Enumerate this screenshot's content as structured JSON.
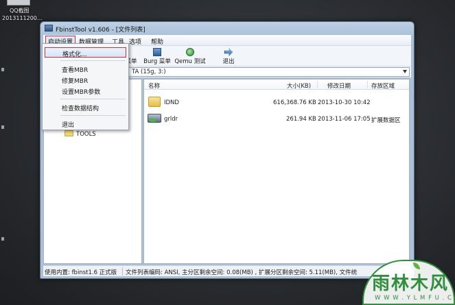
{
  "desktop": {
    "icon_label_1": "QQ截图",
    "icon_label_2": "2013111200..."
  },
  "window": {
    "title": "FbinstTool v1.606 - [文件列表]"
  },
  "menubar": {
    "items": [
      "启动设置",
      "数据管理",
      "工具",
      "选项",
      "帮助"
    ]
  },
  "toolbar": {
    "partial_label": "菜单",
    "burg_label": "Burg 菜单",
    "qemu_label": "Qemu 测试",
    "exit_label": "退出"
  },
  "drive": {
    "partial_value": "TA  (15g, 3:)"
  },
  "tree": {
    "folder": "TOOLS"
  },
  "file_list": {
    "columns": [
      "名称",
      "大小(KB)",
      "修改日期",
      "存放区域"
    ],
    "rows": [
      {
        "name": "IDND",
        "size": "616,368.76 KB",
        "date": "2013-10-30 10:42",
        "area": ""
      },
      {
        "name": "grldr",
        "size": "261.94 KB",
        "date": "2013-11-06 17:05",
        "area": "扩展数据区"
      }
    ]
  },
  "status": {
    "left": "使用内置: fbinst1.6 正式版",
    "right": "文件列表编码: ANSI, 主分区剩余空间: 0.08(MB) , 扩展分区剩余空间: 5.11(MB), 文件统"
  },
  "dropdown": {
    "items": [
      "格式化...",
      "查看MBR",
      "修复MBR",
      "设置MBR参数",
      "检查数据结构",
      "退出"
    ]
  },
  "watermark": {
    "text": "雨林木风",
    "url": "W W W . Y L M F U . C O M"
  }
}
